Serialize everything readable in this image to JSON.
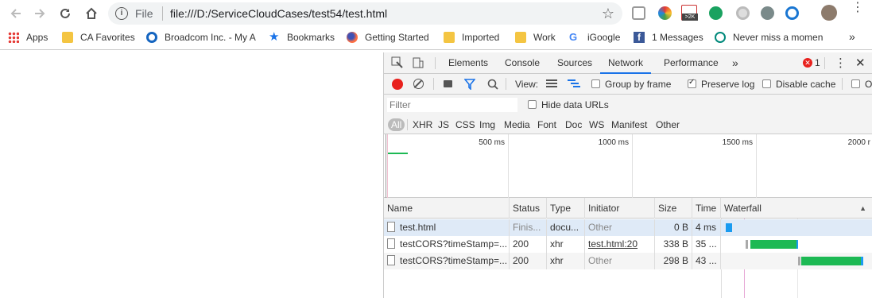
{
  "browser": {
    "scheme_label": "File",
    "url": "file:///D:/ServiceCloudCases/test54/test.html",
    "extension_badge": ">2K"
  },
  "bookmarks": [
    {
      "label": "Apps",
      "icon": "apps-grid-icon"
    },
    {
      "label": "CA Favorites",
      "icon": "folder-icon"
    },
    {
      "label": "Broadcom Inc. - My A",
      "icon": "circle-logo-icon"
    },
    {
      "label": "Bookmarks",
      "icon": "star-icon"
    },
    {
      "label": "Getting Started",
      "icon": "firefox-icon"
    },
    {
      "label": "Imported",
      "icon": "folder-icon"
    },
    {
      "label": "Work",
      "icon": "folder-icon"
    },
    {
      "label": "iGoogle",
      "icon": "google-g-icon"
    },
    {
      "label": "1 Messages",
      "icon": "facebook-icon"
    },
    {
      "label": "Never miss a momen",
      "icon": "play-circle-icon"
    }
  ],
  "bookmarks_more": "»",
  "devtools": {
    "tabs": [
      "Elements",
      "Console",
      "Sources",
      "Network",
      "Performance"
    ],
    "active_tab": "Network",
    "more_tabs": "»",
    "error_count": "1",
    "toolbar": {
      "view_label": "View:",
      "group_by_frame": "Group by frame",
      "preserve_log": "Preserve log",
      "disable_cache": "Disable cache",
      "offline_partial": "O"
    },
    "filter": {
      "placeholder": "Filter",
      "hide_data_urls": "Hide data URLs"
    },
    "types": [
      "All",
      "XHR",
      "JS",
      "CSS",
      "Img",
      "Media",
      "Font",
      "Doc",
      "WS",
      "Manifest",
      "Other"
    ],
    "active_type": "All",
    "overview_ticks": [
      "500 ms",
      "1000 ms",
      "1500 ms",
      "2000 r"
    ],
    "columns": [
      "Name",
      "Status",
      "Type",
      "Initiator",
      "Size",
      "Time",
      "Waterfall"
    ],
    "rows": [
      {
        "name": "test.html",
        "status": "Finis...",
        "type": "docu...",
        "initiator": "Other",
        "size": "0 B",
        "time": "4 ms"
      },
      {
        "name": "testCORS?timeStamp=...",
        "status": "200",
        "type": "xhr",
        "initiator": "test.html:20",
        "size": "338 B",
        "time": "35 ..."
      },
      {
        "name": "testCORS?timeStamp=...",
        "status": "200",
        "type": "xhr",
        "initiator": "Other",
        "size": "298 B",
        "time": "43 ..."
      }
    ]
  },
  "colors": {
    "accent_blue": "#1a73e8",
    "waterfall_green": "#1db954",
    "waterfall_blue": "#1a9bf0",
    "selected_row": "#dfeaf7",
    "record_red": "#e8211d"
  }
}
